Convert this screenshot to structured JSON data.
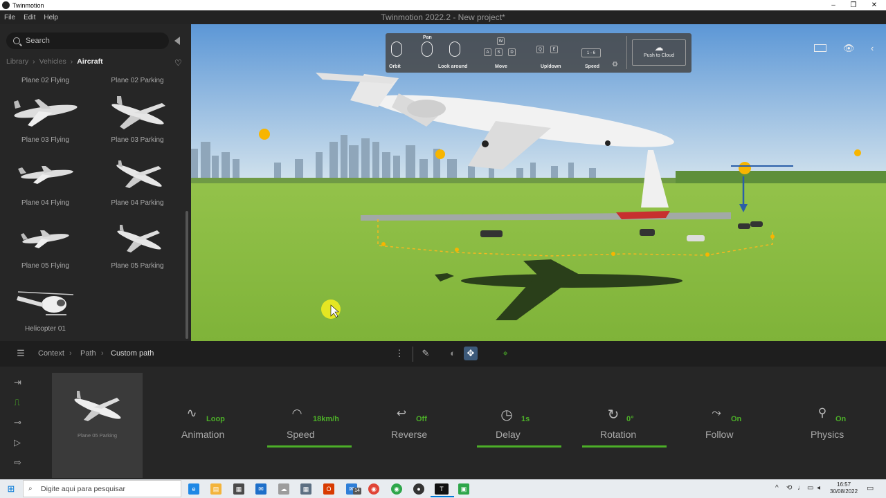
{
  "window": {
    "app_name": "Twinmotion",
    "title": "Twinmotion 2022.2 - New project*",
    "controls": [
      "–",
      "❐",
      "✕"
    ]
  },
  "menu": [
    "File",
    "Edit",
    "Help"
  ],
  "library": {
    "search_placeholder": "Search",
    "breadcrumb": [
      "Library",
      "Vehicles",
      "Aircraft"
    ],
    "items": [
      {
        "label": "Plane 02 Flying"
      },
      {
        "label": "Plane 02 Parking"
      },
      {
        "label": "Plane 03 Flying"
      },
      {
        "label": "Plane 03 Parking"
      },
      {
        "label": "Plane 04 Flying"
      },
      {
        "label": "Plane 04 Parking"
      },
      {
        "label": "Plane 05 Flying"
      },
      {
        "label": "Plane 05 Parking"
      },
      {
        "label": "Helicopter 01"
      }
    ]
  },
  "navigation_help": {
    "pan": "Pan",
    "orbit": "Orbit",
    "look_around": "Look around",
    "move": "Move",
    "updown": "Up/down",
    "speed": "Speed",
    "speed_keys": "1 - 6",
    "keys_move": [
      "W",
      "A",
      "S",
      "D"
    ],
    "keys_updown": [
      "Q",
      "E"
    ],
    "push_to_cloud": "Push to Cloud"
  },
  "toolbar": {
    "crumbs": [
      "Context",
      "Path",
      "Custom path"
    ]
  },
  "selection": {
    "thumbnail_caption": "Plane 05 Parking"
  },
  "properties": [
    {
      "label": "Animation",
      "value": "Loop",
      "active": false
    },
    {
      "label": "Speed",
      "value": "18km/h",
      "active": true
    },
    {
      "label": "Reverse",
      "value": "Off",
      "active": false
    },
    {
      "label": "Delay",
      "value": "1s",
      "active": true
    },
    {
      "label": "Rotation",
      "value": "0°",
      "active": true
    },
    {
      "label": "Follow",
      "value": "On",
      "active": false
    },
    {
      "label": "Physics",
      "value": "On",
      "active": false
    }
  ],
  "taskbar": {
    "search_placeholder": "Digite aqui para pesquisar",
    "badge": "14",
    "time": "16:57",
    "date": "30/08/2022"
  },
  "colors": {
    "accent_green": "#4caf28",
    "sky_top": "#5c97d6",
    "grass": "#8cc043"
  }
}
